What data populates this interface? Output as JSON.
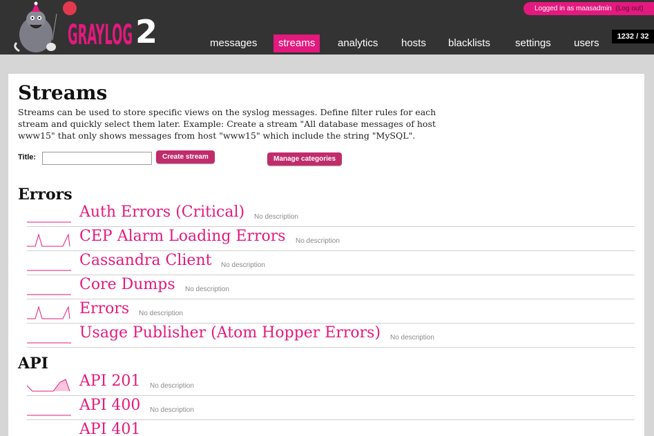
{
  "header": {
    "logo_text": "GRAYLOG2",
    "user_prefix": "Logged in as maasadmin",
    "logout_label": "(Log out)",
    "counter": "1232 / 32",
    "nav": [
      {
        "label": "messages",
        "active": false
      },
      {
        "label": "streams",
        "active": true
      },
      {
        "label": "analytics",
        "active": false
      },
      {
        "label": "hosts",
        "active": false
      },
      {
        "label": "blacklists",
        "active": false
      },
      {
        "label": "settings",
        "active": false
      },
      {
        "label": "users",
        "active": false
      }
    ]
  },
  "page": {
    "title": "Streams",
    "description": "Streams can be used to store specific views on the syslog messages. Define filter rules for each stream and quickly select them later. Example: Create a stream \"All database messages of host www15\" that only shows messages from host \"www15\" which include the string \"MySQL\".",
    "form": {
      "title_label": "Title:",
      "title_value": "",
      "create_label": "Create stream",
      "manage_label": "Manage categories"
    }
  },
  "categories": [
    {
      "name": "Errors",
      "streams": [
        {
          "name": "Auth Errors (Critical)",
          "description": "No description",
          "sparkline": "flat"
        },
        {
          "name": "CEP Alarm Loading Errors",
          "description": "No description",
          "sparkline": "spikes"
        },
        {
          "name": "Cassandra Client",
          "description": "No description",
          "sparkline": "flat"
        },
        {
          "name": "Core Dumps",
          "description": "No description",
          "sparkline": "flat"
        },
        {
          "name": "Errors",
          "description": "No description",
          "sparkline": "spikes"
        },
        {
          "name": "Usage Publisher (Atom Hopper Errors)",
          "description": "No description",
          "sparkline": "flat"
        }
      ]
    },
    {
      "name": "API",
      "streams": [
        {
          "name": "API 201",
          "description": "No description",
          "sparkline": "ramp"
        },
        {
          "name": "API 400",
          "description": "No description",
          "sparkline": "flat"
        },
        {
          "name": "API 401",
          "description": "",
          "sparkline": "flat"
        }
      ]
    }
  ],
  "colors": {
    "accent": "#e3197e",
    "button": "#c12c6b",
    "header_bg": "#333333",
    "page_bg": "#d6d6d6"
  }
}
